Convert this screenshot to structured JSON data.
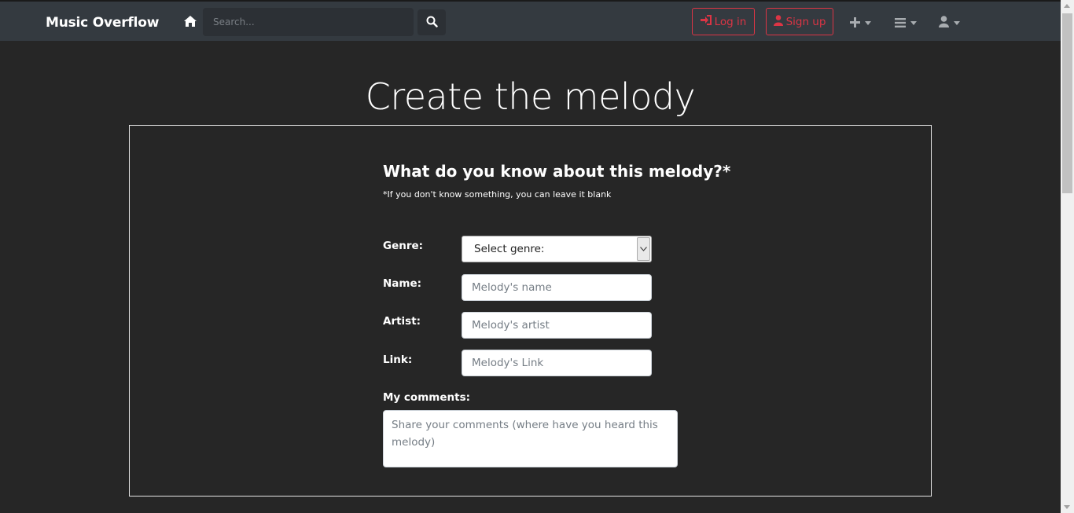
{
  "navbar": {
    "brand": "Music Overflow",
    "search_placeholder": "Search...",
    "login_label": "Log in",
    "signup_label": "Sign up",
    "icons": [
      "home-icon",
      "search-icon",
      "login-icon",
      "user-plus-icon",
      "plus-icon",
      "menu-icon",
      "user-icon"
    ]
  },
  "page": {
    "title": "Create the melody"
  },
  "form": {
    "heading": "What do you know about this melody?*",
    "note": "*If you don't know something, you can leave it blank",
    "genre_label": "Genre:",
    "genre_selected": "Select genre:",
    "name_label": "Name:",
    "name_placeholder": "Melody's name",
    "artist_label": "Artist:",
    "artist_placeholder": "Melody's artist",
    "link_label": "Link:",
    "link_placeholder": "Melody's Link",
    "comments_label": "My comments:",
    "comments_placeholder": "Share your comments (where have you heard this melody)"
  },
  "colors": {
    "background": "#262626",
    "navbar": "#343a40",
    "accent_danger": "#dc3545"
  }
}
